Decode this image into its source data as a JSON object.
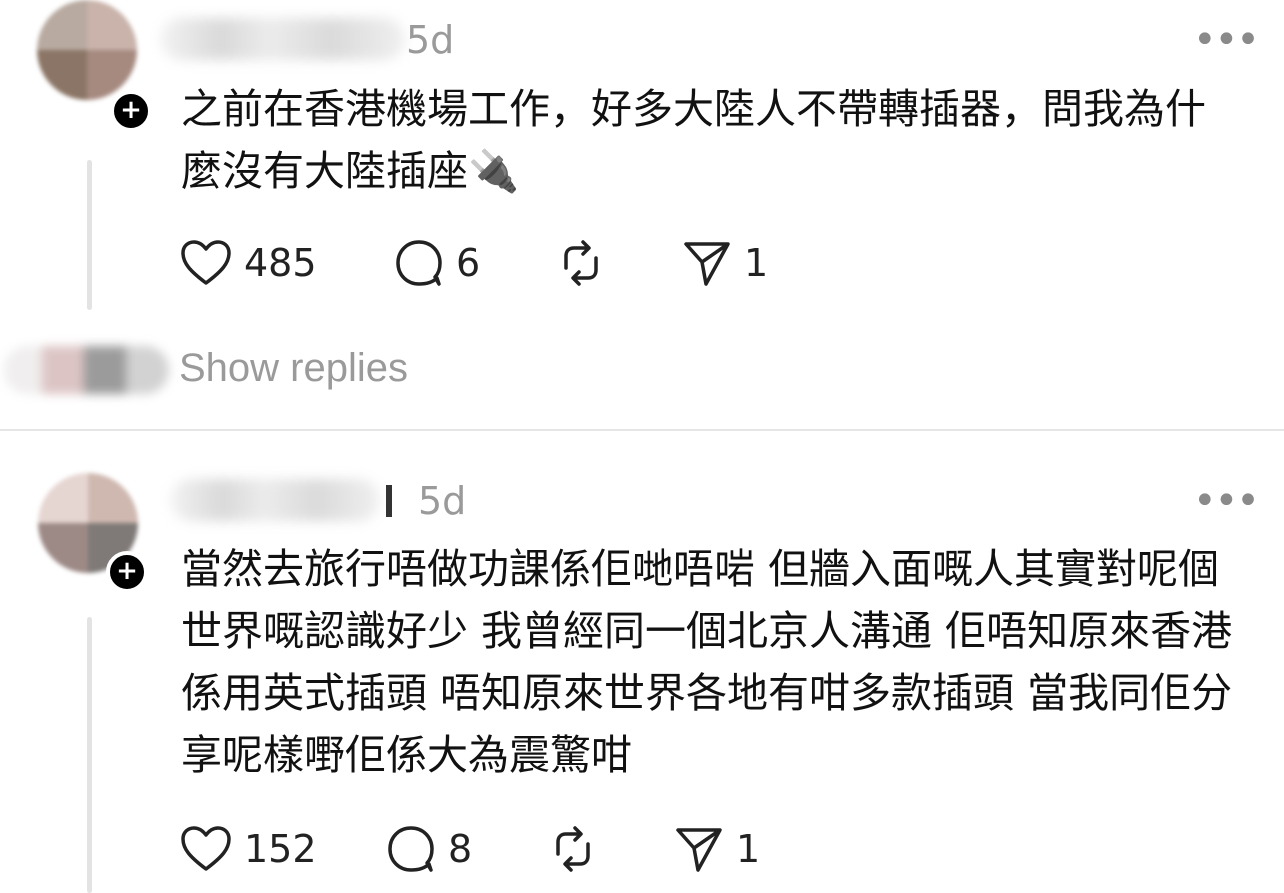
{
  "posts": [
    {
      "time": "5d",
      "text": "之前在香港機場工作，好多大陸人不帶轉插器，問我為什麼沒有大陸插座🔌",
      "likes": "485",
      "comments": "6",
      "reposts": "",
      "shares": "1"
    },
    {
      "time": "5d",
      "text": "當然去旅行唔做功課係佢哋唔啱 但牆入面嘅人其實對呢個世界嘅認識好少 我曾經同一個北京人溝通 佢唔知原來香港係用英式插頭 唔知原來世界各地有咁多款插頭 當我同佢分享呢樣嘢佢係大為震驚咁",
      "likes": "152",
      "comments": "8",
      "reposts": "",
      "shares": "1"
    }
  ],
  "show_replies": "Show replies",
  "more_label": "•••",
  "follow_badge": "+",
  "colors": {
    "muted_text": "#9a9a9a",
    "thread_line": "#e3e3e3",
    "divider": "#e6e6e6",
    "icon": "#222222"
  },
  "icons": [
    "heart-icon",
    "comment-icon",
    "repost-icon",
    "share-icon",
    "more-icon",
    "plug-icon"
  ]
}
